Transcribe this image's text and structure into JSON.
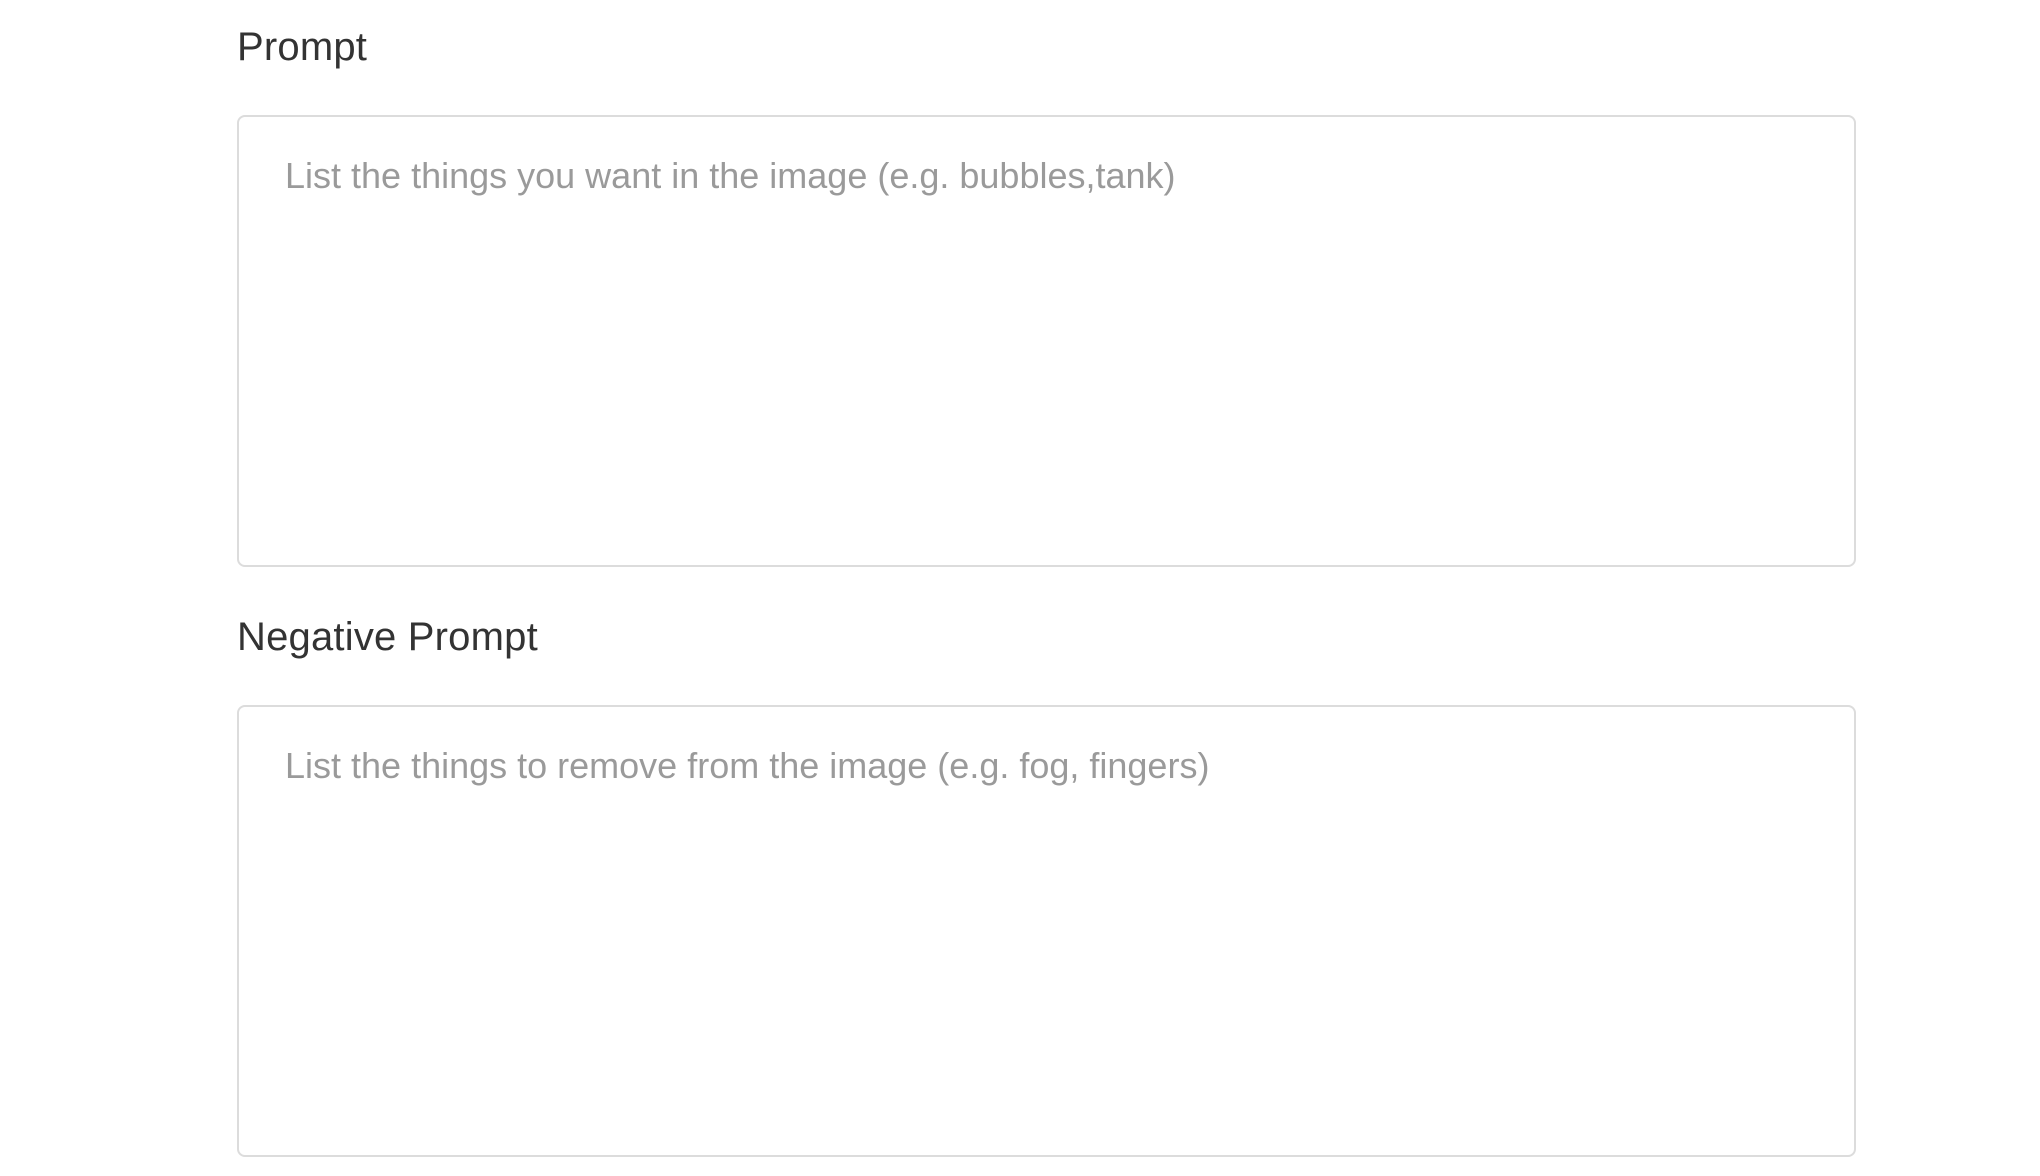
{
  "prompt": {
    "label": "Prompt",
    "value": "",
    "placeholder": "List the things you want in the image (e.g. bubbles,tank)"
  },
  "negative_prompt": {
    "label": "Negative Prompt",
    "value": "",
    "placeholder": "List the things to remove from the image (e.g. fog, fingers)"
  },
  "colors": {
    "label_text": "#333333",
    "placeholder_text": "#9a9a9a",
    "input_border": "#dcdcdc",
    "background": "#ffffff"
  }
}
